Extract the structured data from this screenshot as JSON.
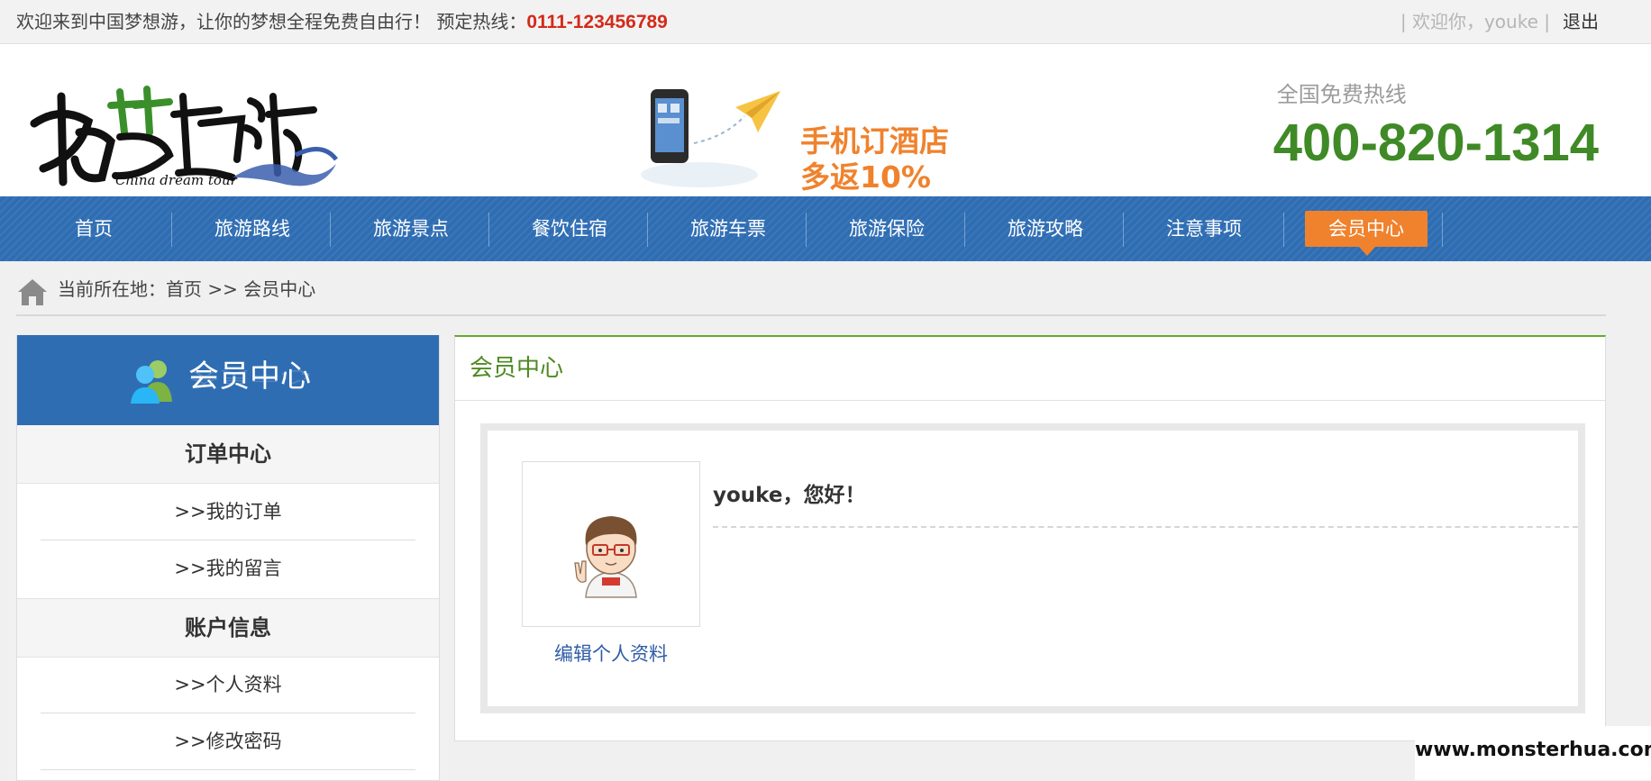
{
  "topbar": {
    "welcome_text": "欢迎来到中国梦想游，让你的梦想全程免费自由行！ 预定热线：",
    "hotline": "0111-123456789",
    "user_greeting": "| 欢迎你，youke |",
    "logout": "退出"
  },
  "header": {
    "promo_line1": "手机订酒店",
    "promo_line2": "多返10%",
    "hotline_label": "全国免费热线",
    "hotline_number": "400-820-1314"
  },
  "nav": {
    "items": [
      {
        "label": "首页"
      },
      {
        "label": "旅游路线"
      },
      {
        "label": "旅游景点"
      },
      {
        "label": "餐饮住宿"
      },
      {
        "label": "旅游车票"
      },
      {
        "label": "旅游保险"
      },
      {
        "label": "旅游攻略"
      },
      {
        "label": "注意事项"
      },
      {
        "label": "会员中心"
      }
    ],
    "active_color": "#f0822d",
    "bar_color": "#2f6db3"
  },
  "breadcrumb": {
    "text": "当前所在地：首页 >> 会员中心"
  },
  "sidebar": {
    "title": "会员中心",
    "sections": [
      {
        "title": "订单中心",
        "links": [
          ">>我的订单",
          ">>我的留言"
        ]
      },
      {
        "title": "账户信息",
        "links": [
          ">>个人资料",
          ">>修改密码"
        ]
      }
    ]
  },
  "main": {
    "title": "会员中心",
    "edit_profile": "编辑个人资料",
    "greeting": "youke，您好！",
    "accent_color": "#4e8a22"
  },
  "watermark": "www.monsterhua.com"
}
